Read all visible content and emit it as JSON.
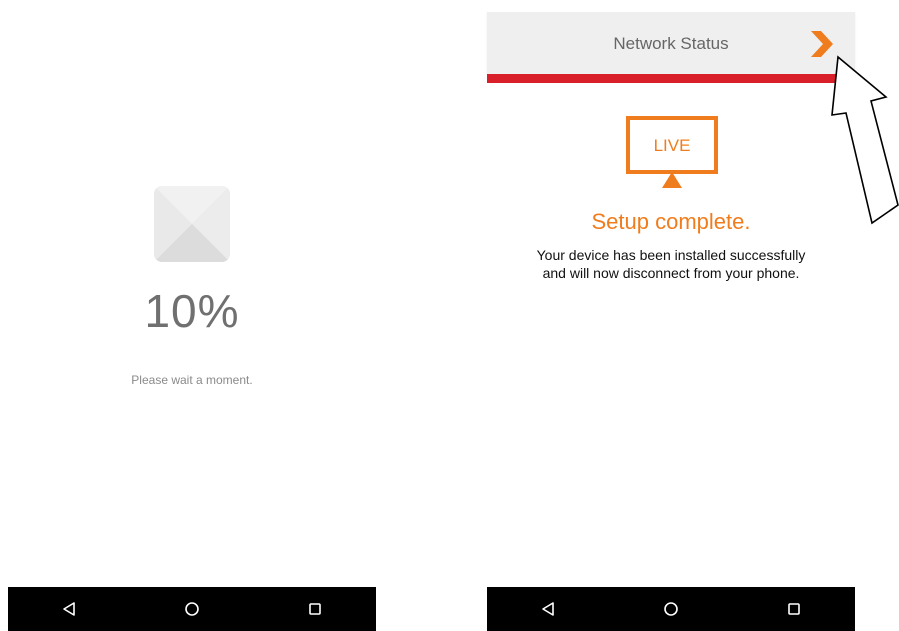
{
  "left_screen": {
    "progress_percent": 10,
    "progress_text": "10%",
    "wait_message": "Please wait a moment."
  },
  "right_screen": {
    "header_title": "Network Status",
    "live_label": "LIVE",
    "setup_title": "Setup complete.",
    "setup_message_line1": "Your device has been installed successfully",
    "setup_message_line2": "and will now disconnect from your phone."
  },
  "navbar": {
    "back_icon": "back-triangle-icon",
    "home_icon": "home-circle-icon",
    "recents_icon": "recents-square-icon"
  },
  "colors": {
    "accent_orange": "#f07d1d",
    "header_red": "#d9202a",
    "header_bg": "#efefef",
    "navbar_bg": "#000000"
  }
}
